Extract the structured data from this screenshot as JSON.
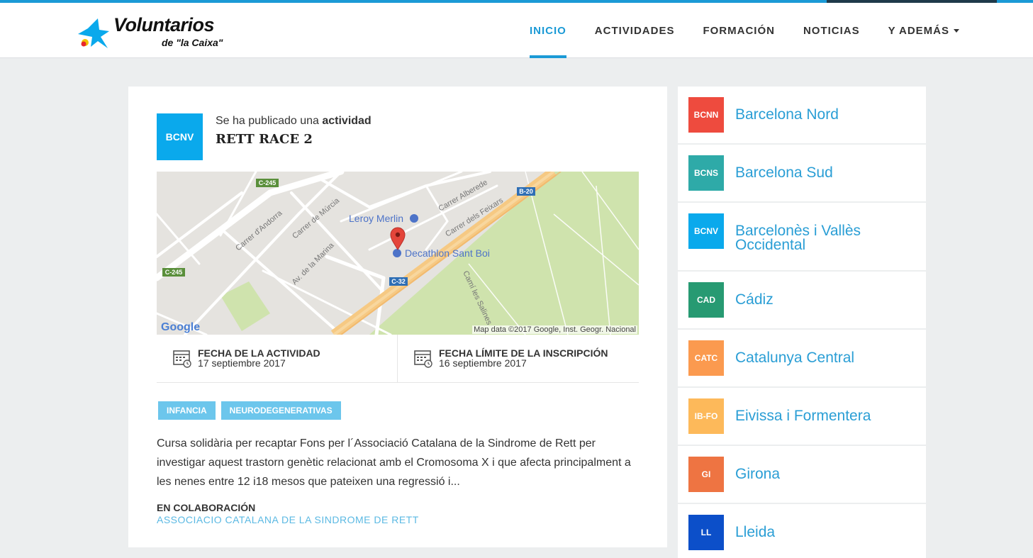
{
  "header": {
    "brand": "Voluntarios",
    "brand_sub": "de \"la Caixa\"",
    "nav": [
      {
        "label": "INICIO",
        "active": true
      },
      {
        "label": "ACTIVIDADES",
        "active": false
      },
      {
        "label": "FORMACIÓN",
        "active": false
      },
      {
        "label": "NOTICIAS",
        "active": false
      },
      {
        "label": "Y ADEMÁS",
        "active": false,
        "dropdown": true
      }
    ]
  },
  "colors": {
    "accent": "#1b9ad6",
    "tag": "#6cc6ec",
    "link": "#2a9ed5"
  },
  "activity": {
    "badge": "BCNV",
    "published_prefix": "Se ha publicado una ",
    "published_type": "actividad",
    "title": "RETT RACE 2",
    "map": {
      "labels": {
        "road_c245_top": "C-245",
        "road_c245_left": "C-245",
        "road_b20": "B-20",
        "road_c32": "C-32",
        "street_andorra": "Carrer d'Andorra",
        "street_murcia": "Carrer de Múrcia",
        "street_marina": "Av. de la Marina",
        "street_feixars": "Carrer dels Feixars",
        "street_alberede": "Carrer Alberede",
        "street_salines": "Camí les Salines",
        "poi_leroy": "Leroy Merlin",
        "poi_decathlon": "Decathlon Sant Boi",
        "google": "Google"
      },
      "copyright": "Map data ©2017 Google, Inst. Geogr. Nacional"
    },
    "dates": [
      {
        "label": "FECHA DE LA ACTIVIDAD",
        "value": "17 septiembre 2017",
        "icon": "calendar-icon"
      },
      {
        "label": "FECHA LÍMITE DE LA INSCRIPCIÓN",
        "value": "16 septiembre 2017",
        "icon": "calendar-icon"
      }
    ],
    "tags": [
      "INFANCIA",
      "NEURODEGENERATIVAS"
    ],
    "description": "Cursa solidària per recaptar Fons per l´Associació Catalana de la Sindrome de Rett per investigar aquest trastorn genètic relacionat amb el Cromosoma X i que afecta principalment a les nenes entre 12 i18 mesos que pateixen una regressió i...",
    "collab_label": "EN COLABORACIÓN",
    "collab_value": "ASSOCIACIO CATALANA DE LA SINDROME DE RETT"
  },
  "sidebar": {
    "items": [
      {
        "code": "BCNN",
        "name": "Barcelona Nord",
        "color": "#ee4b3e"
      },
      {
        "code": "BCNS",
        "name": "Barcelona Sud",
        "color": "#2eaaa8"
      },
      {
        "code": "BCNV",
        "name": "Barcelonès i Vallès Occidental",
        "color": "#0aa9ec"
      },
      {
        "code": "CAD",
        "name": "Cádiz",
        "color": "#279a72"
      },
      {
        "code": "CATC",
        "name": "Catalunya Central",
        "color": "#fb9a4f"
      },
      {
        "code": "IB-FO",
        "name": "Eivissa i Formentera",
        "color": "#fdb95a"
      },
      {
        "code": "GI",
        "name": "Girona",
        "color": "#ee7442"
      },
      {
        "code": "LL",
        "name": "Lleida",
        "color": "#0c4fc9"
      }
    ]
  }
}
